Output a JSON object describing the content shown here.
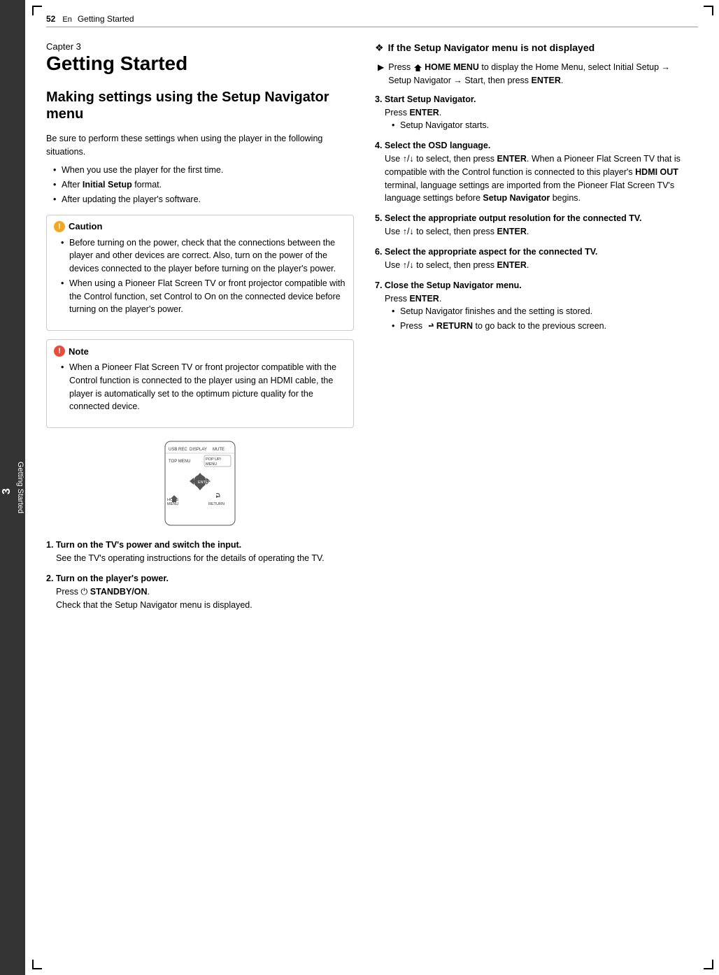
{
  "header": {
    "page_number": "52",
    "section_label": "Getting Started",
    "lang_code": "En"
  },
  "sidebar": {
    "number": "3",
    "label": "Getting Started"
  },
  "left_column": {
    "chapter_label": "Capter 3",
    "chapter_title": "Getting Started",
    "section_title": "Making settings using the Setup Navigator menu",
    "intro_text": "Be sure to perform these settings when using the player in the following situations.",
    "bullet_items": [
      "When you use the player for the first time.",
      "After Initial Setup format.",
      "After updating the player's software."
    ],
    "caution": {
      "header": "Caution",
      "items": [
        "Before turning on the power, check that the connections between the player and other devices are correct. Also, turn on the power of the devices connected to the player before turning on the player's power.",
        "When using a Pioneer Flat Screen TV or front projector compatible with the Control function, set Control to On on the connected device before turning on the player's power."
      ]
    },
    "note": {
      "header": "Note",
      "items": [
        "When a Pioneer Flat Screen TV or front projector compatible with the Control function is connected to the player using an HDMI cable, the player is automatically set to the optimum picture quality for the connected device."
      ]
    },
    "steps_left": [
      {
        "number": "1.",
        "title": "Turn on the TV's power and switch the input.",
        "body": "See the TV's operating instructions for the details of operating the TV."
      },
      {
        "number": "2.",
        "title": "Turn on the player's power.",
        "body_line1": "Press",
        "body_standby": "STANDBY/ON",
        "body_line2": ".",
        "body_line3": "Check that the Setup Navigator menu is displayed."
      }
    ]
  },
  "right_column": {
    "if_not_displayed_title": "If the Setup Navigator menu is not displayed",
    "press_instruction": "Press",
    "press_home": "HOME MENU",
    "press_text": "to display the Home Menu, select Initial Setup → Setup Navigator → Start, then press ENTER.",
    "steps_right": [
      {
        "number": "3.",
        "title": "Start Setup Navigator.",
        "body_line1": "Press ENTER.",
        "bullets": [
          "Setup Navigator starts."
        ]
      },
      {
        "number": "4.",
        "title": "Select the OSD language.",
        "body": "Use ↑/↓ to select, then press ENTER. When a Pioneer Flat Screen TV that is compatible with the Control function is connected to this player's HDMI OUT terminal, language settings are imported from the Pioneer Flat Screen TV's language settings before Setup Navigator begins."
      },
      {
        "number": "5.",
        "title": "Select the appropriate output resolution for the connected TV.",
        "body": "Use ↑/↓ to select, then press ENTER."
      },
      {
        "number": "6.",
        "title": "Select the appropriate aspect for the connected TV.",
        "body": "Use ↑/↓ to select, then press ENTER."
      },
      {
        "number": "7.",
        "title": "Close the Setup Navigator menu.",
        "body_line1": "Press ENTER.",
        "bullets": [
          "Setup Navigator finishes and the setting is stored.",
          "Press RETURN to go back to the previous screen."
        ]
      }
    ]
  }
}
